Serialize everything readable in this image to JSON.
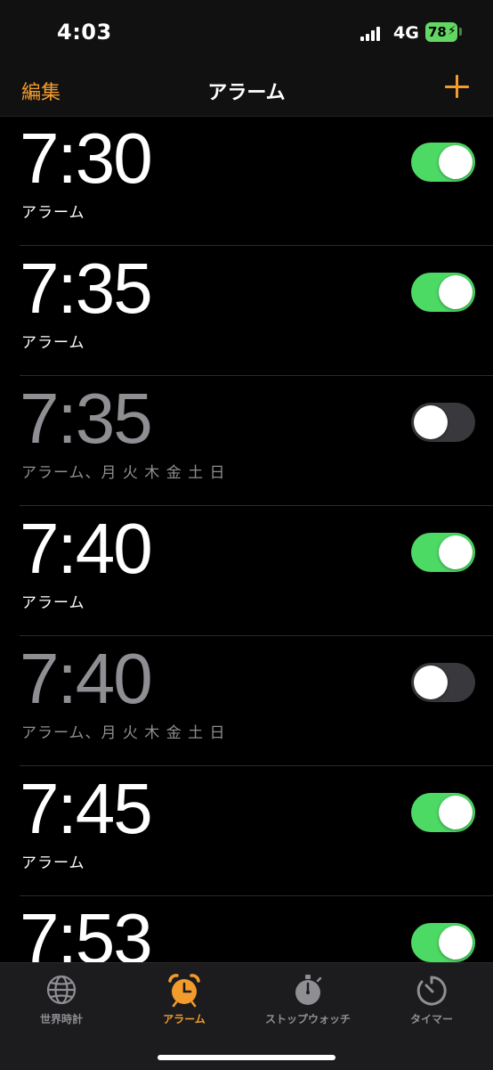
{
  "status": {
    "time": "4:03",
    "network": "4G",
    "battery": "78"
  },
  "nav": {
    "edit_label": "編集",
    "title": "アラーム"
  },
  "alarms": [
    {
      "time": "7:30",
      "label": "アラーム",
      "enabled": true
    },
    {
      "time": "7:35",
      "label": "アラーム",
      "enabled": true
    },
    {
      "time": "7:35",
      "label": "アラーム、月 火 木 金 土 日",
      "enabled": false
    },
    {
      "time": "7:40",
      "label": "アラーム",
      "enabled": true
    },
    {
      "time": "7:40",
      "label": "アラーム、月 火 木 金 土 日",
      "enabled": false
    },
    {
      "time": "7:45",
      "label": "アラーム",
      "enabled": true
    },
    {
      "time": "7:53",
      "label": "",
      "enabled": true
    }
  ],
  "tabs": [
    {
      "label": "世界時計",
      "icon": "globe-icon",
      "active": false
    },
    {
      "label": "アラーム",
      "icon": "alarm-clock-icon",
      "active": true
    },
    {
      "label": "ストップウォッチ",
      "icon": "stopwatch-icon",
      "active": false
    },
    {
      "label": "タイマー",
      "icon": "timer-icon",
      "active": false
    }
  ],
  "colors": {
    "accent": "#f39c2b",
    "toggle_on": "#4cd964",
    "toggle_off": "#39393d",
    "inactive_text": "#8e8e93"
  }
}
